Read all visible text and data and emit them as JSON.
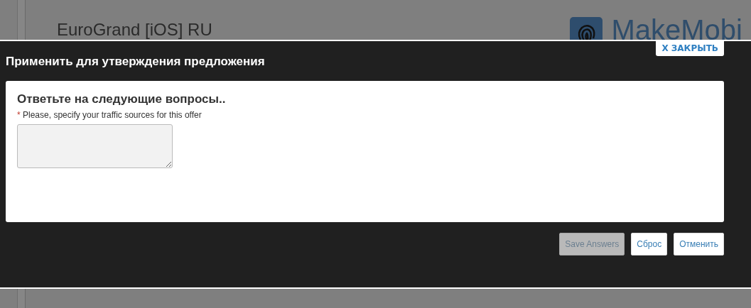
{
  "background_page": {
    "title": "EuroGrand [iOS] RU",
    "logo_text": "MakeMobi"
  },
  "dialog": {
    "title": "Применить для утверждения предложения",
    "close_button": "X ЗАКРЫТЬ",
    "heading": "Ответьте на следующие вопросы..",
    "questions": [
      {
        "required_mark": "*",
        "label": "Please, specify your traffic sources for this offer"
      }
    ],
    "buttons": [
      {
        "label": "Save Answers",
        "disabled": true
      },
      {
        "label": "Сброс",
        "disabled": false
      },
      {
        "label": "Отменить",
        "disabled": false
      }
    ]
  }
}
